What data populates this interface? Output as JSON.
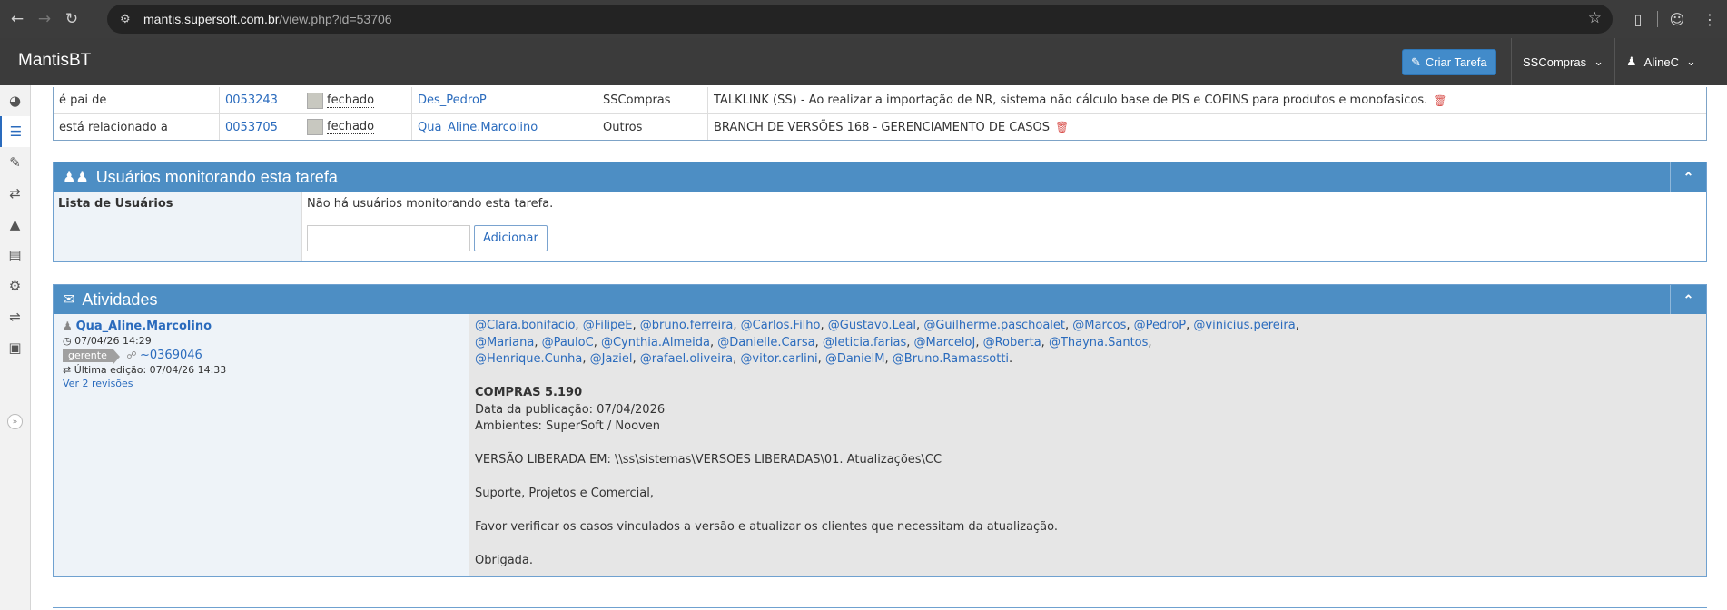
{
  "browser": {
    "url_host": "mantis.supersoft.com.br",
    "url_path": "/view.php?id=53706"
  },
  "navbar": {
    "brand": "MantisBT",
    "create_label": "Criar Tarefa",
    "project": "SSCompras",
    "user": "AlineC"
  },
  "relations": [
    {
      "relation": "é pai de",
      "id": "0053243",
      "status": "fechado",
      "handler": "Des_PedroP",
      "project": "SSCompras",
      "summary": "TALKLINK (SS) - Ao realizar a importação de NR, sistema não cálculo base de PIS e COFINS para produtos e monofasicos."
    },
    {
      "relation": "está relacionado a",
      "id": "0053705",
      "status": "fechado",
      "handler": "Qua_Aline.Marcolino",
      "project": "Outros",
      "summary": "BRANCH DE VERSÕES 168 - GERENCIAMENTO DE CASOS"
    }
  ],
  "monitor": {
    "title": "Usuários monitorando esta tarefa",
    "label": "Lista de Usuários",
    "empty_text": "Não há usuários monitorando esta tarefa.",
    "add_label": "Adicionar"
  },
  "activities": {
    "title": "Atividades",
    "author": "Qua_Aline.Marcolino",
    "date": "07/04/26 14:29",
    "role": "gerente",
    "note_id": "~0369046",
    "last_edit": "Última edição: 07/04/26 14:33",
    "revisions": "Ver 2 revisões",
    "mentions_line1": [
      "@Clara.bonifacio",
      "@FilipeE",
      "@bruno.ferreira",
      "@Carlos.Filho",
      "@Gustavo.Leal",
      "@Guilherme.paschoalet",
      "@Marcos",
      "@PedroP",
      "@vinicius.pereira"
    ],
    "mentions_line2": [
      "@Mariana",
      "@PauloC",
      "@Cynthia.Almeida",
      "@Danielle.Carsa",
      "@leticia.farias",
      "@MarceloJ",
      "@Roberta",
      "@Thayna.Santos"
    ],
    "mentions_line3": [
      "@Henrique.Cunha",
      "@Jaziel",
      "@rafael.oliveira",
      "@vitor.carlini",
      "@DanielM",
      "@Bruno.Ramassotti"
    ],
    "heading": "COMPRAS 5.190",
    "pub_date": "Data da publicação: 07/04/2026",
    "environments": "Ambientes: SuperSoft / Nooven",
    "release_path": "VERSÃO LIBERADA EM: \\\\ss\\sistemas\\VERSOES LIBERADAS\\01. Atualizações\\CC",
    "greeting": "Suporte, Projetos e Comercial,",
    "body": "Favor verificar os casos vinculados a versão e atualizar os clientes que necessitam da atualização.",
    "closing": "Obrigada."
  }
}
